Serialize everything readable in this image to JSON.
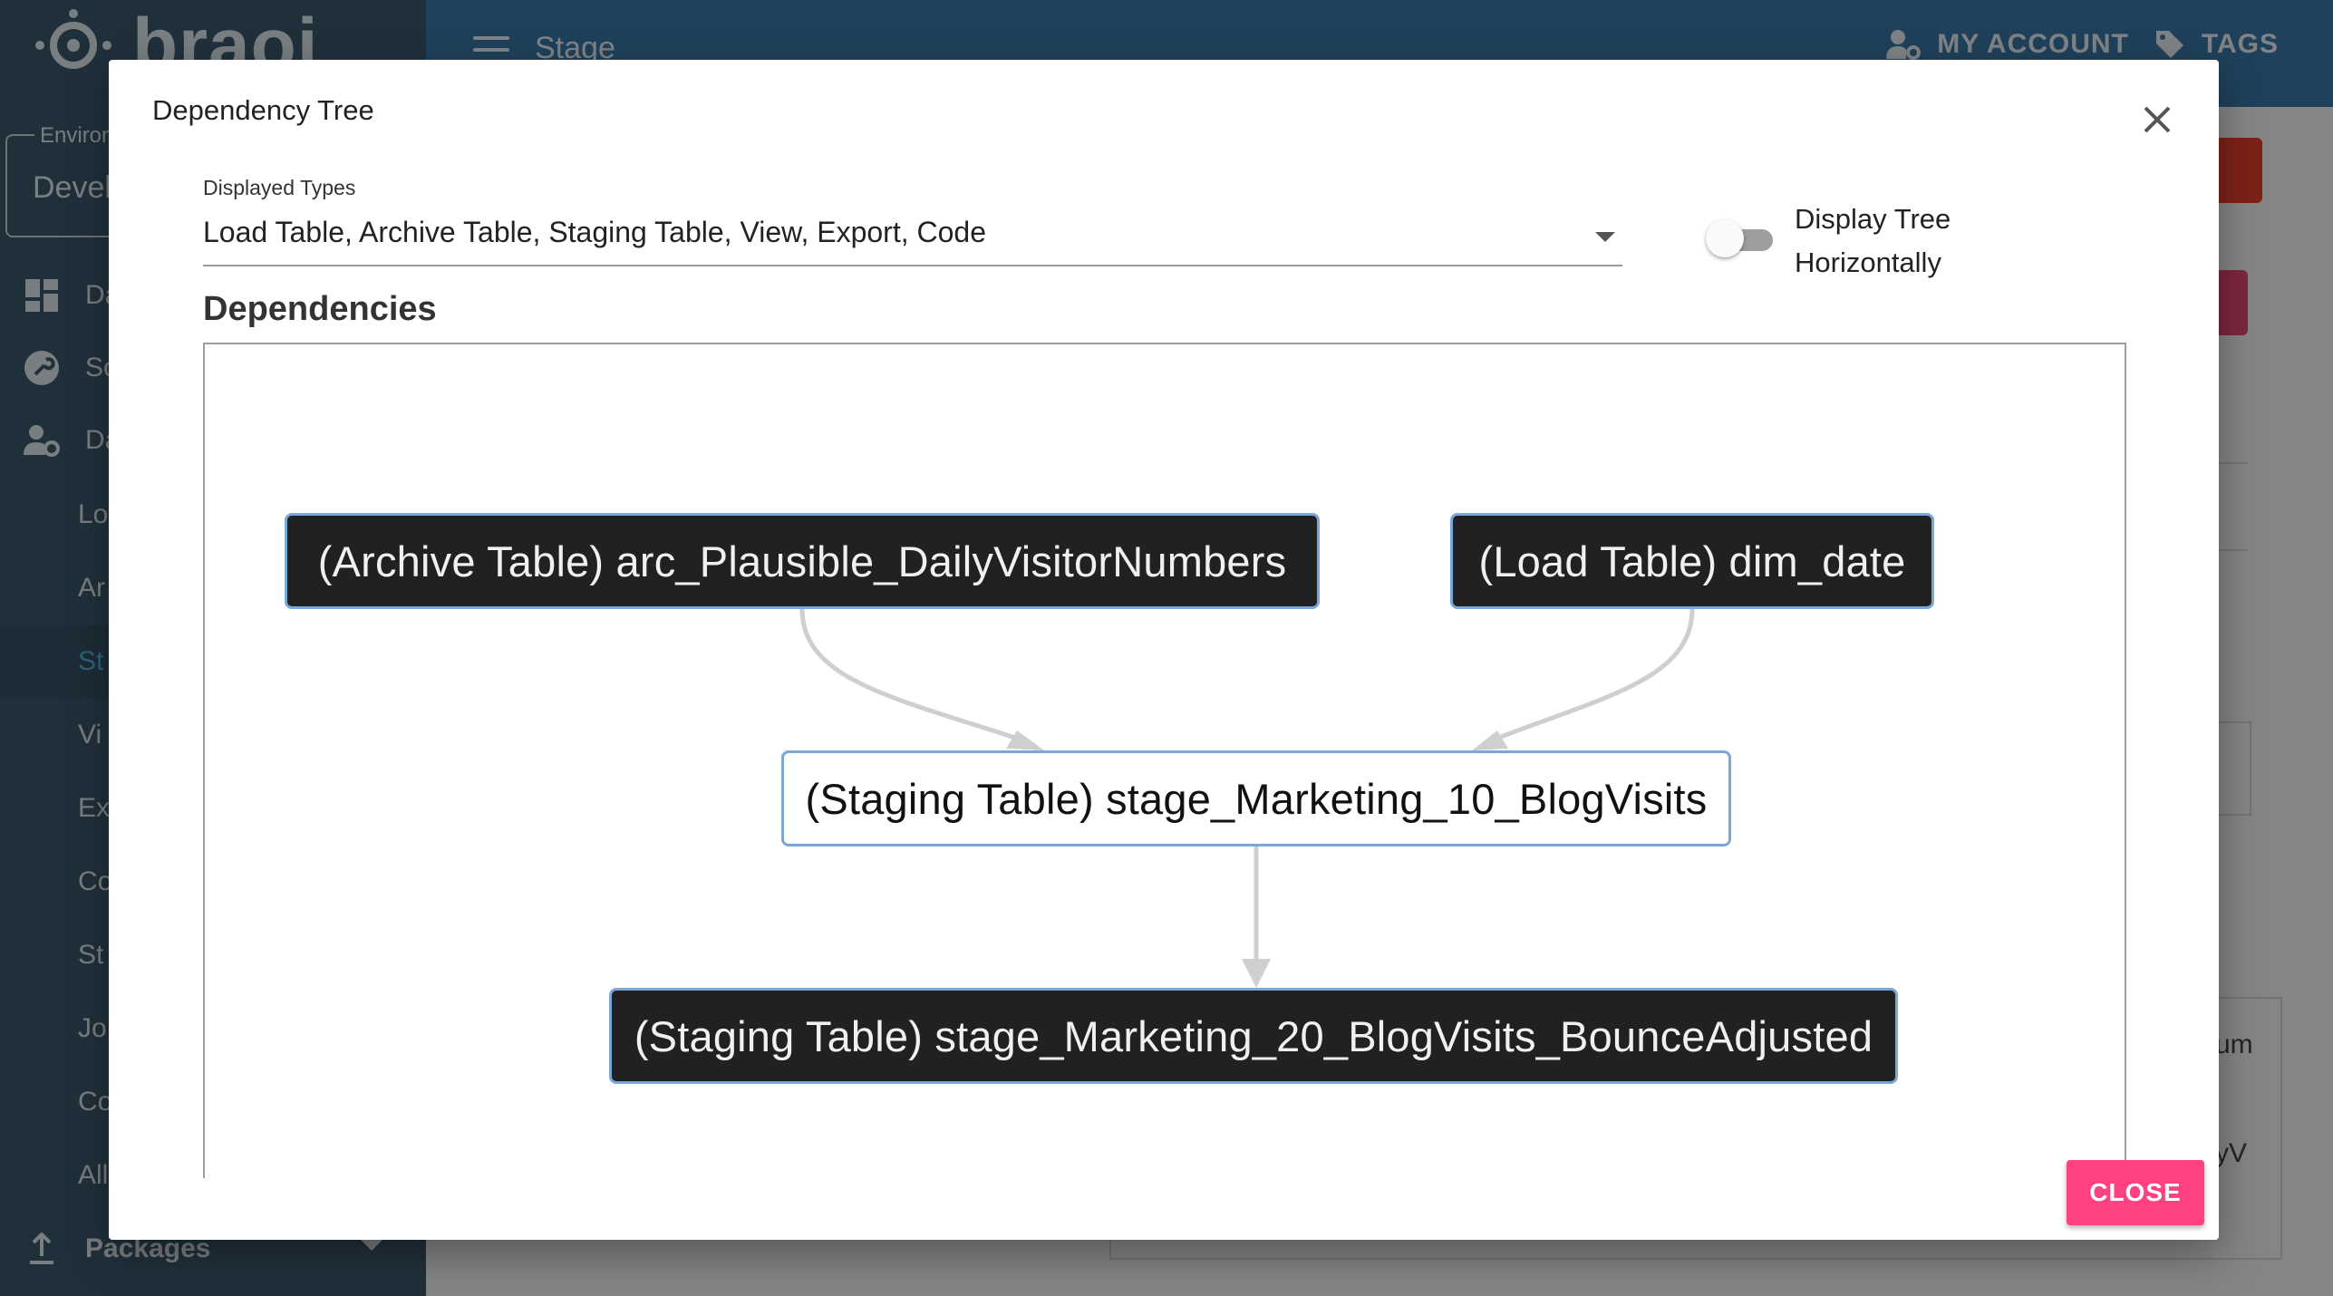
{
  "app": {
    "logo_text": "braoi",
    "environment_label": "Environ",
    "environment_value": "Develo",
    "page_title": "Stage",
    "my_account": "MY ACCOUNT",
    "tags": "TAGS"
  },
  "sidebar": {
    "items": [
      {
        "label": "Da",
        "icon": "dashboard-icon"
      },
      {
        "label": "Sc",
        "icon": "wrench-icon"
      },
      {
        "label": "Da",
        "icon": "users-gear-icon"
      }
    ],
    "subitems": [
      "Lo",
      "Ar",
      "St",
      "Vi",
      "Ex",
      "Co",
      "St",
      "Jo",
      "Co",
      "All"
    ],
    "active_subitem_index": 2,
    "packages_label": "Packages"
  },
  "background_fragments": [
    "um",
    "yV"
  ],
  "dialog": {
    "title": "Dependency Tree",
    "displayed_types_label": "Displayed Types",
    "displayed_types_value": "Load Table, Archive Table, Staging Table, View, Export, Code",
    "toggle_label": "Display Tree Horizontally",
    "toggle_on": false,
    "section_heading": "Dependencies",
    "nodes": [
      {
        "label": "(Archive Table) arc_Plausible_DailyVisitorNumbers",
        "style": "dark"
      },
      {
        "label": "(Load Table) dim_date",
        "style": "dark"
      },
      {
        "label": "(Staging Table) stage_Marketing_10_BlogVisits",
        "style": "light"
      },
      {
        "label": "(Staging Table) stage_Marketing_20_BlogVisits_BounceAdjusted",
        "style": "dark"
      }
    ],
    "close_button": "CLOSE"
  },
  "colors": {
    "node_dark": "#212121",
    "node_border": "#7aa7d8",
    "close_button": "#ff4081",
    "sidebar": "#3c5a6e",
    "topbar": "#3a79a8"
  }
}
